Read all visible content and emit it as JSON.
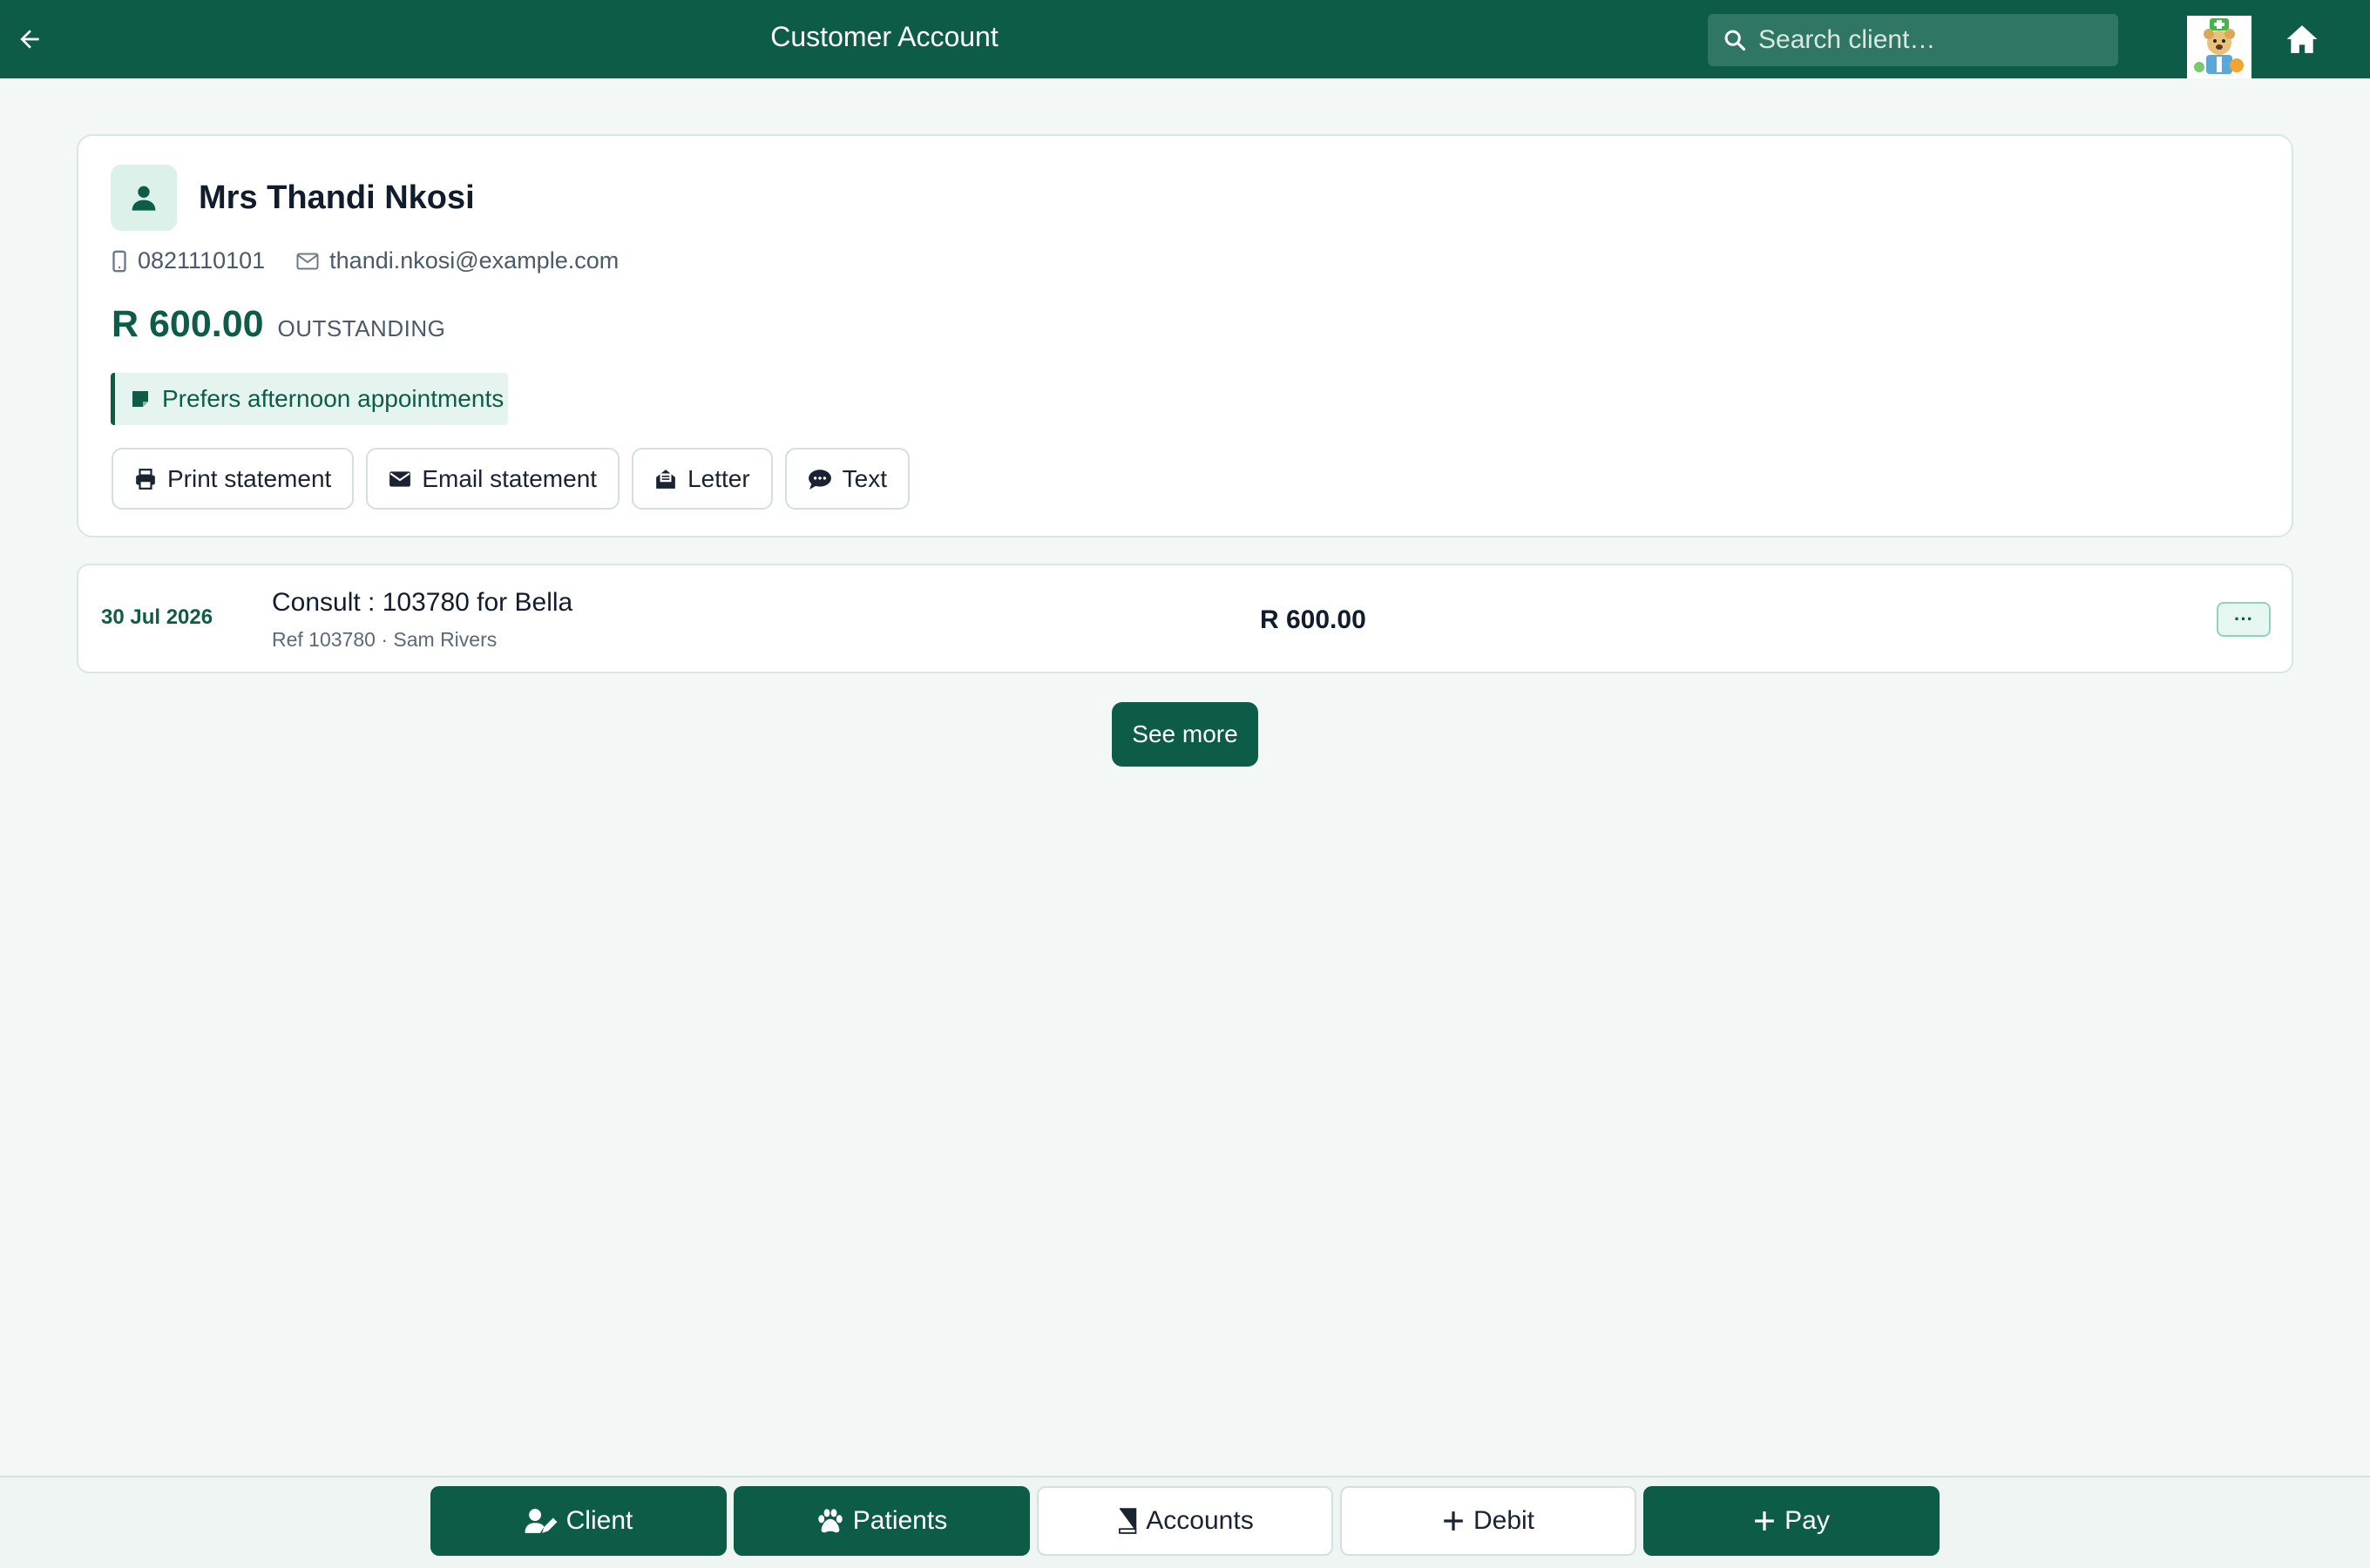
{
  "header": {
    "title": "Customer Account",
    "search_placeholder": "Search client…"
  },
  "client": {
    "name": "Mrs Thandi Nkosi",
    "phone": "0821110101",
    "email": "thandi.nkosi@example.com",
    "balance": "R 600.00",
    "balance_label": "OUTSTANDING",
    "note": "Prefers afternoon appointments",
    "actions": [
      {
        "label": "Print statement",
        "icon": "printer-icon"
      },
      {
        "label": "Email statement",
        "icon": "envelope-icon"
      },
      {
        "label": "Letter",
        "icon": "letter-icon"
      },
      {
        "label": "Text",
        "icon": "sms-icon"
      }
    ]
  },
  "transactions": [
    {
      "date": "30 Jul 2026",
      "description": "Consult : 103780 for Bella",
      "ref": "Ref 103780",
      "separator": "·",
      "person": "Sam Rivers",
      "amount": "R 600.00",
      "more": "···"
    }
  ],
  "see_more_label": "See more",
  "bottom_nav": [
    {
      "label": "Client",
      "icon": "user-edit-icon",
      "style": "dark"
    },
    {
      "label": "Patients",
      "icon": "paw-icon",
      "style": "dark"
    },
    {
      "label": "Accounts",
      "icon": "book-icon",
      "style": "light"
    },
    {
      "label": "Debit",
      "icon": "plus-icon",
      "style": "light"
    },
    {
      "label": "Pay",
      "icon": "plus-icon",
      "style": "dark"
    }
  ],
  "colors": {
    "brand": "#0d5c48",
    "background": "#f3f8f7",
    "note_bg": "#e6f4ef"
  }
}
